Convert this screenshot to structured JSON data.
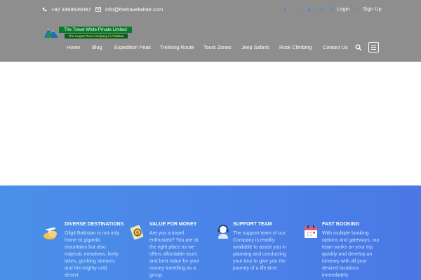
{
  "topbar": {
    "phone": "+92 3469535097",
    "email": "info@thetravelwhite.com",
    "socials": [
      "twitter-icon",
      "facebook-icon",
      "instagram-icon",
      "pinterest-icon"
    ],
    "login_label": "Login",
    "signup_label": "Sign Up"
  },
  "logo": {
    "title": "The Travel White Private Limited",
    "tagline": "The Largest Tour Company in Pakistan"
  },
  "nav": {
    "items": [
      "Home",
      "Blog",
      "Expedition Peak",
      "Trekking Route",
      "Tours Zones",
      "Jeep Safaris",
      "Rock Climbing",
      "Contact Us"
    ]
  },
  "features": [
    {
      "title": "DIVERSE DESTINATIONS",
      "text": "Gilgit Baltistan is not only home to gigantic mountains but also majestic meadows, lively lakes, gushing streams and the mighty cold desert."
    },
    {
      "title": "VALUE FOR MONEY",
      "text": "Are you a travel enthusiast? You are at the right place as we offers affordable tours and best value for your money travelling as a group."
    },
    {
      "title": "SUPPORT TEAM",
      "text": "The support team of our Company is readily available to assist you in planning and conducting your tour to give you the journey of a life time."
    },
    {
      "title": "FAST BOOKING",
      "text": "With multiple booking options and gateways, our team works on your trip quickly and develop an itinerary with all your desired locations immediately."
    }
  ],
  "colors": {
    "header_bg": "#8e8e8e",
    "accent": "#3b8fe5",
    "features_bg": "#4a86e8"
  }
}
